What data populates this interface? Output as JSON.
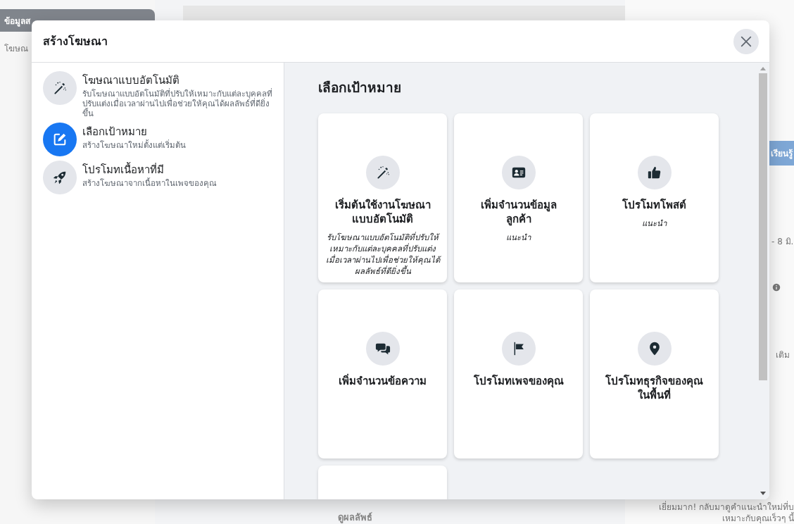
{
  "background": {
    "sidebar_title": "ข้อมูลส",
    "sidebar_item": "โฆษณ",
    "learn_button": "เรียนรู้",
    "date": "- 8 มิ.",
    "more": "เติม",
    "results_link": "ดูผลลัพธ์",
    "notice": [
      "เยี่ยมมาก! กลับมาดูคำแนะนำใหม่ที่บ",
      "เหมาะกับคุณเร็วๆ นี้"
    ]
  },
  "dialog": {
    "title": "สร้างโฆษณา"
  },
  "menu": [
    {
      "title": "โฆษณาแบบอัตโนมัติ",
      "subtitle": "รับโฆษณาแบบอัตโนมัติที่ปรับให้เหมาะกับแต่ละบุคคลที่ปรับแต่งเมื่อเวลาผ่านไปเพื่อช่วยให้คุณได้ผลลัพธ์ที่ดียิ่งขึ้น",
      "selected": false
    },
    {
      "title": "เลือกเป้าหมาย",
      "subtitle": "สร้างโฆษณาใหม่ตั้งแต่เริ่มต้น",
      "selected": true
    },
    {
      "title": "โปรโมทเนื้อหาที่มี",
      "subtitle": "สร้างโฆษณาจากเนื้อหาในเพจของคุณ",
      "selected": false
    }
  ],
  "content": {
    "heading": "เลือกเป้าหมาย",
    "cards": [
      {
        "kind": "goal",
        "title": "เริ่มต้นใช้งานโฆษณาแบบอัตโนมัติ",
        "note": "รับโฆษณาแบบอัตโนมัติที่ปรับให้เหมาะกับแต่ละบุคคลที่ปรับแต่งเมื่อเวลาผ่านไปเพื่อช่วยให้คุณได้ผลลัพธ์ที่ดียิ่งขึ้น"
      },
      {
        "kind": "goal",
        "title": "เพิ่มจำนวนข้อมูลลูกค้า",
        "note": "แนะนำ"
      },
      {
        "kind": "goal",
        "title": "โปรโมทโพสต์",
        "note": "แนะนำ"
      },
      {
        "kind": "goal",
        "title": "เพิ่มจำนวนข้อความ"
      },
      {
        "kind": "goal",
        "title": "โปรโมทเพจของคุณ"
      },
      {
        "kind": "goal",
        "title": "โปรโมทธุรกิจของคุณในพื้นที่"
      },
      {
        "kind": "blank"
      }
    ]
  }
}
